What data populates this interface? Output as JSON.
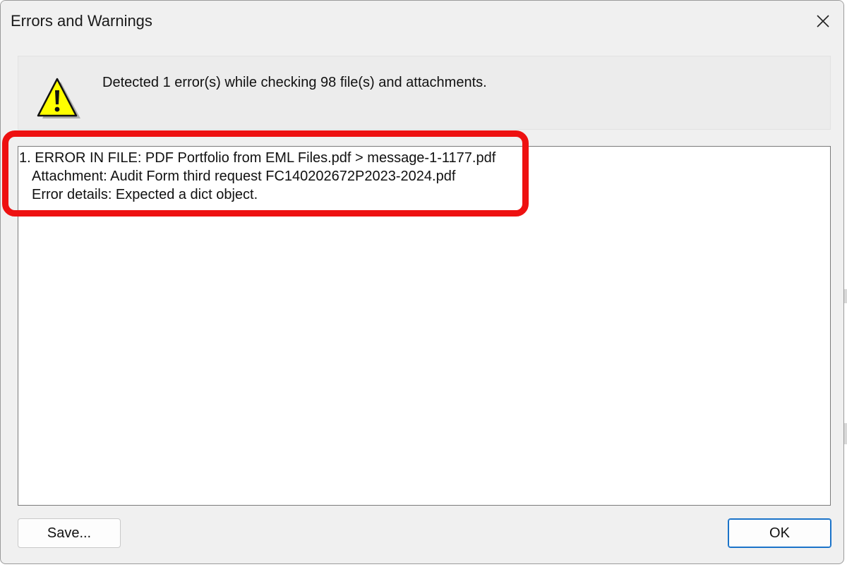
{
  "window": {
    "title": "Errors and Warnings"
  },
  "header": {
    "message": "Detected 1 error(s) while checking 98 file(s) and attachments."
  },
  "log": {
    "lines": [
      "1. ERROR IN FILE: PDF Portfolio from EML Files.pdf > message-1-1177.pdf",
      "Attachment: Audit Form third request FC140202672P2023-2024.pdf",
      "Error details: Expected a dict object."
    ]
  },
  "buttons": {
    "save": "Save...",
    "ok": "OK"
  },
  "colors": {
    "highlight": "#ee1111",
    "warning_fill": "#ffff00",
    "ok_border": "#1a73c9"
  },
  "icons": {
    "close": "close-icon",
    "warning": "warning-icon"
  }
}
